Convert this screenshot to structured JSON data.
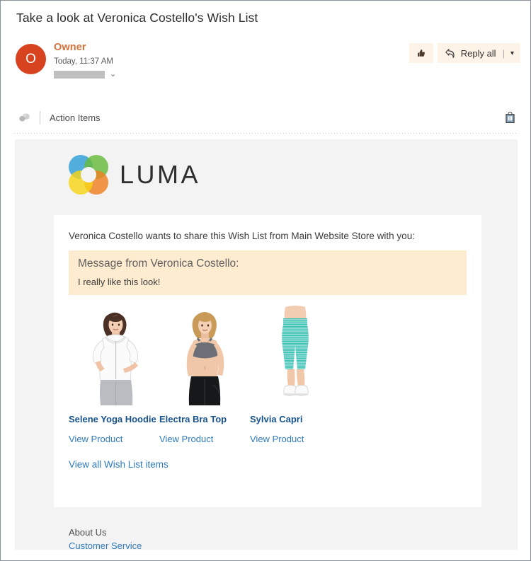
{
  "window": {
    "subject": "Take a look at Veronica Costello's Wish List"
  },
  "sender": {
    "avatar_initial": "O",
    "avatar_color": "#d8431f",
    "name": "Owner",
    "name_color": "#d4703a",
    "timestamp": "Today, 11:37 AM",
    "recipient_redacted": "",
    "expand_icon": "chevron-double-down-icon"
  },
  "top_actions": {
    "like_icon": "thumbs-up-icon",
    "reply_icon": "reply-all-arrow-icon",
    "reply_label": "Reply all",
    "separator": "|",
    "caret_icon": "chevron-down-icon"
  },
  "action_items": {
    "left_icon": "insights-brain-icon",
    "label": "Action Items",
    "right_icon": "shopping-bag-icon"
  },
  "email": {
    "brand": {
      "logo_icon": "luma-rings-logo",
      "wordmark": "LUMA",
      "colors": {
        "blue": "#2e9fd8",
        "green": "#67bb3b",
        "orange": "#ef8022",
        "yellow": "#f6d416"
      }
    },
    "intro": "Veronica Costello wants to share this Wish List from Main Website Store with you:",
    "message": {
      "title": "Message from Veronica Costello:",
      "body": "I really like this look!",
      "background": "#fdecd0"
    },
    "products": [
      {
        "name": "Selene Yoga Hoodie",
        "link_label": "View Product",
        "image_alt": "woman-in-white-hoodie"
      },
      {
        "name": "Electra Bra Top",
        "link_label": "View Product",
        "image_alt": "woman-in-gray-sports-bra"
      },
      {
        "name": "Sylvia Capri",
        "link_label": "View Product",
        "image_alt": "teal-striped-capri-leggings"
      }
    ],
    "view_all_label": "View all Wish List items",
    "footer": {
      "about_label": "About Us",
      "customer_service_label": "Customer Service"
    }
  }
}
